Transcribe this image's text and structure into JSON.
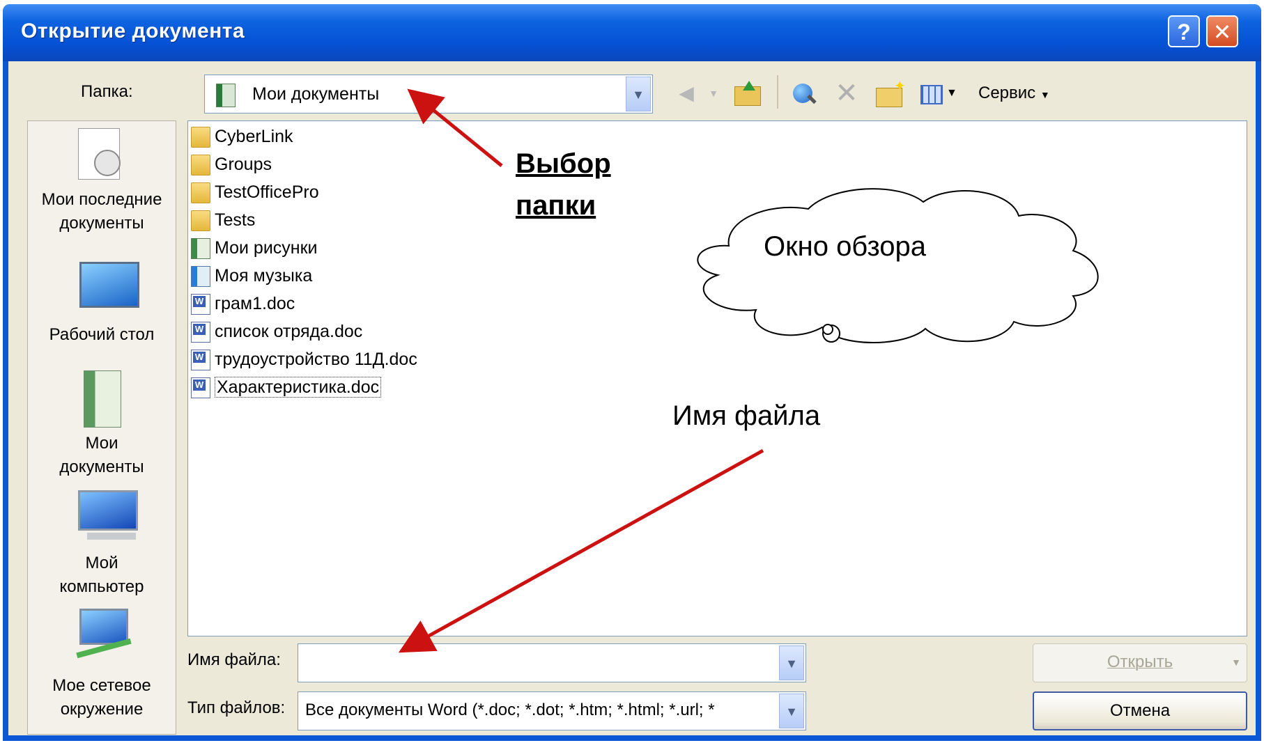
{
  "window": {
    "title": "Открытие документа",
    "help_label": "?",
    "close_label": "✕"
  },
  "toolbar": {
    "folder_label": "Папка:",
    "folder_value": "Мои документы",
    "service_label": "Сервис",
    "icons": [
      "back-icon",
      "up-folder-icon",
      "web-search-icon",
      "delete-icon",
      "new-folder-icon",
      "views-icon"
    ]
  },
  "places": [
    {
      "line1": "Мои последние",
      "line2": "документы"
    },
    {
      "line1": "Рабочий стол",
      "line2": ""
    },
    {
      "line1": "Мои",
      "line2": "документы"
    },
    {
      "line1": "Мой",
      "line2": "компьютер"
    },
    {
      "line1": "Мое сетевое",
      "line2": "окружение"
    }
  ],
  "files": [
    {
      "name": "CyberLink",
      "icon": "folder"
    },
    {
      "name": "Groups",
      "icon": "folder"
    },
    {
      "name": "TestOfficePro",
      "icon": "folder"
    },
    {
      "name": "Tests",
      "icon": "folder"
    },
    {
      "name": "Мои рисунки",
      "icon": "pictures-folder"
    },
    {
      "name": "Моя музыка",
      "icon": "music-folder"
    },
    {
      "name": "грам1.doc",
      "icon": "word-doc"
    },
    {
      "name": "список отряда.doc",
      "icon": "word-doc"
    },
    {
      "name": "трудоустройство 11Д.doc",
      "icon": "word-doc"
    },
    {
      "name": "Характеристика.doc",
      "icon": "word-doc"
    }
  ],
  "fields": {
    "filename_label": "Имя файла:",
    "filename_value": "",
    "filetype_label": "Тип файлов:",
    "filetype_value": "Все документы Word (*.doc; *.dot; *.htm; *.html; *.url; *"
  },
  "buttons": {
    "open": "Открыть",
    "cancel": "Отмена"
  },
  "annotations": {
    "folder_choice_line1": "Выбор",
    "folder_choice_line2": "папки",
    "browse_window": "Окно обзора",
    "file_name": "Имя файла",
    "arrow_color": "#cc1111"
  }
}
